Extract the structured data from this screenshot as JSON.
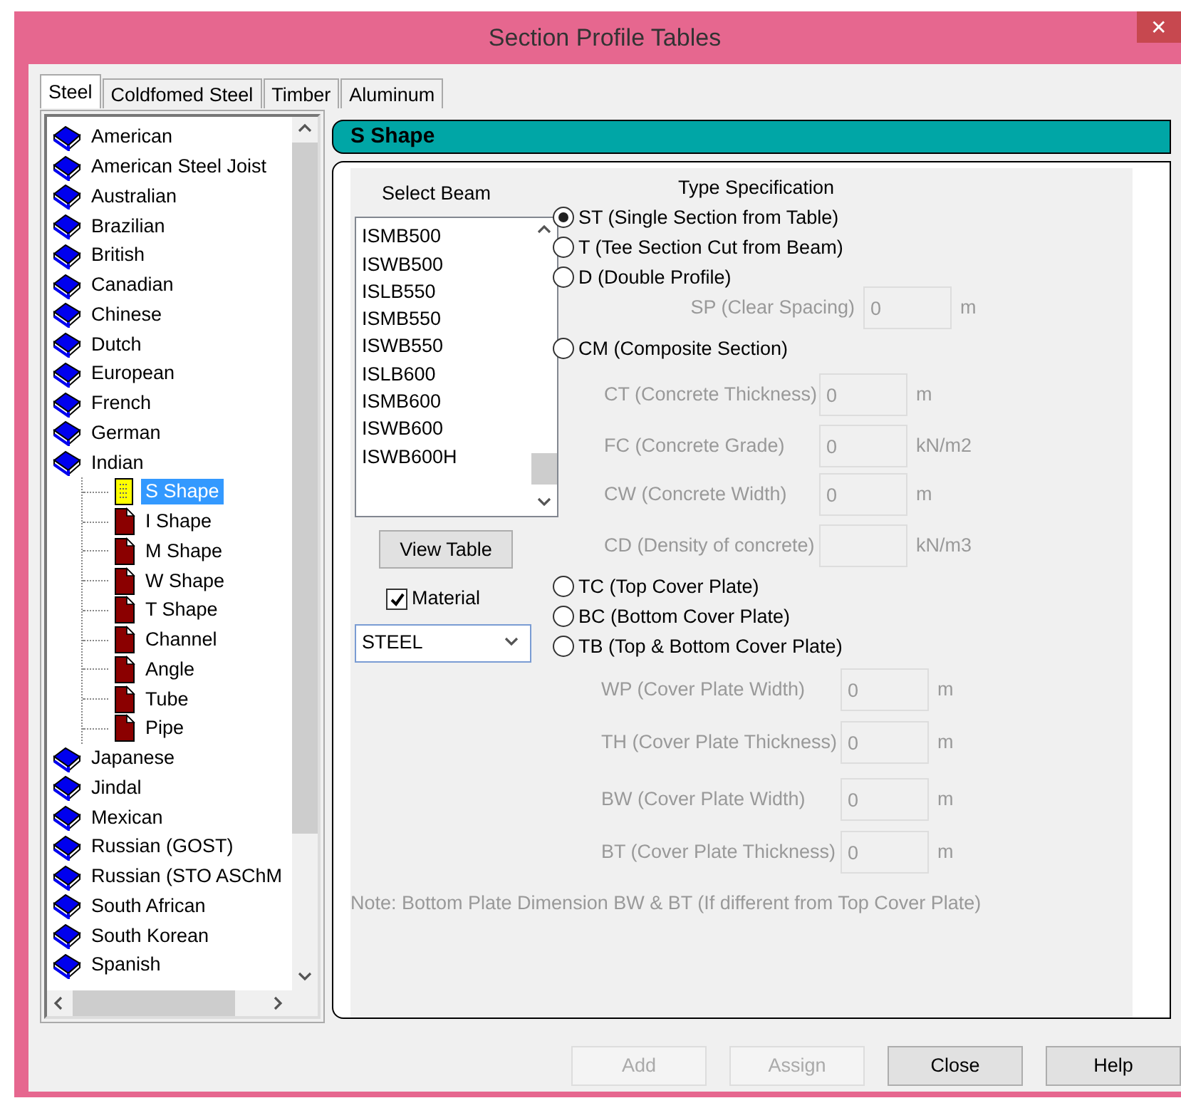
{
  "window": {
    "title": "Section Profile Tables",
    "close": "✕"
  },
  "tabs": [
    {
      "label": "Steel",
      "selected": true
    },
    {
      "label": "Coldfomed Steel",
      "selected": false
    },
    {
      "label": "Timber",
      "selected": false
    },
    {
      "label": "Aluminum",
      "selected": false
    }
  ],
  "tree": [
    {
      "label": "American"
    },
    {
      "label": "American Steel Joist"
    },
    {
      "label": "Australian"
    },
    {
      "label": "Brazilian"
    },
    {
      "label": "British"
    },
    {
      "label": "Canadian"
    },
    {
      "label": "Chinese"
    },
    {
      "label": "Dutch"
    },
    {
      "label": "European"
    },
    {
      "label": "French"
    },
    {
      "label": "German"
    },
    {
      "label": "Indian",
      "children": [
        {
          "label": "S Shape",
          "selected": true
        },
        {
          "label": "I Shape",
          "selected": false
        },
        {
          "label": "M Shape",
          "selected": false
        },
        {
          "label": "W Shape",
          "selected": false
        },
        {
          "label": "T Shape",
          "selected": false
        },
        {
          "label": "Channel",
          "selected": false
        },
        {
          "label": "Angle",
          "selected": false
        },
        {
          "label": "Tube",
          "selected": false
        },
        {
          "label": "Pipe",
          "selected": false
        }
      ]
    },
    {
      "label": "Japanese"
    },
    {
      "label": "Jindal"
    },
    {
      "label": "Mexican"
    },
    {
      "label": "Russian (GOST)"
    },
    {
      "label": "Russian (STO ASChM"
    },
    {
      "label": "South African"
    },
    {
      "label": "South Korean"
    },
    {
      "label": "Spanish"
    }
  ],
  "panel_title": "S Shape",
  "select_beam": {
    "label": "Select Beam",
    "items": [
      "ISMB500",
      "ISWB500",
      "ISLB550",
      "ISMB550",
      "ISWB550",
      "ISLB600",
      "ISMB600",
      "ISWB600",
      "ISWB600H"
    ]
  },
  "view_table_button": "View Table",
  "material": {
    "label": "Material",
    "checked": true,
    "value": "STEEL"
  },
  "type_specification": {
    "label": "Type Specification",
    "options": [
      {
        "label": "ST (Single Section from Table)",
        "selected": true
      },
      {
        "label": "T (Tee Section Cut from Beam)",
        "selected": false
      },
      {
        "label": "D (Double Profile)",
        "selected": false,
        "fields": [
          {
            "label": "SP (Clear Spacing)",
            "value": "0",
            "unit": "m",
            "disabled": true
          }
        ]
      },
      {
        "label": "CM (Composite Section)",
        "selected": false,
        "fields": [
          {
            "label": "CT (Concrete Thickness)",
            "value": "0",
            "unit": "m",
            "disabled": true
          },
          {
            "label": "FC (Concrete Grade)",
            "value": "0",
            "unit": "kN/m2",
            "disabled": true
          },
          {
            "label": "CW (Concrete Width)",
            "value": "0",
            "unit": "m",
            "disabled": true
          },
          {
            "label": "CD (Density of concrete)",
            "unit": "kN/m3",
            "disabled": true
          }
        ]
      },
      {
        "label": "TC (Top Cover Plate)",
        "selected": false
      },
      {
        "label": "BC (Bottom Cover Plate)",
        "selected": false
      },
      {
        "label": "TB (Top & Bottom Cover Plate)",
        "selected": false,
        "fields": [
          {
            "label": "WP (Cover Plate Width)",
            "value": "0",
            "unit": "m",
            "disabled": true
          },
          {
            "label": "TH (Cover Plate Thickness)",
            "value": "0",
            "unit": "m",
            "disabled": true
          },
          {
            "label": "BW (Cover Plate Width)",
            "value": "0",
            "unit": "m",
            "disabled": true
          },
          {
            "label": "BT (Cover Plate Thickness)",
            "value": "0",
            "unit": "m",
            "disabled": true
          }
        ]
      }
    ]
  },
  "note": "Note: Bottom Plate Dimension BW & BT (If different from Top Cover Plate)",
  "buttons": [
    {
      "label": "Add",
      "disabled": true
    },
    {
      "label": "Assign",
      "disabled": true
    },
    {
      "label": "Close",
      "disabled": false
    },
    {
      "label": "Help",
      "disabled": false
    }
  ]
}
